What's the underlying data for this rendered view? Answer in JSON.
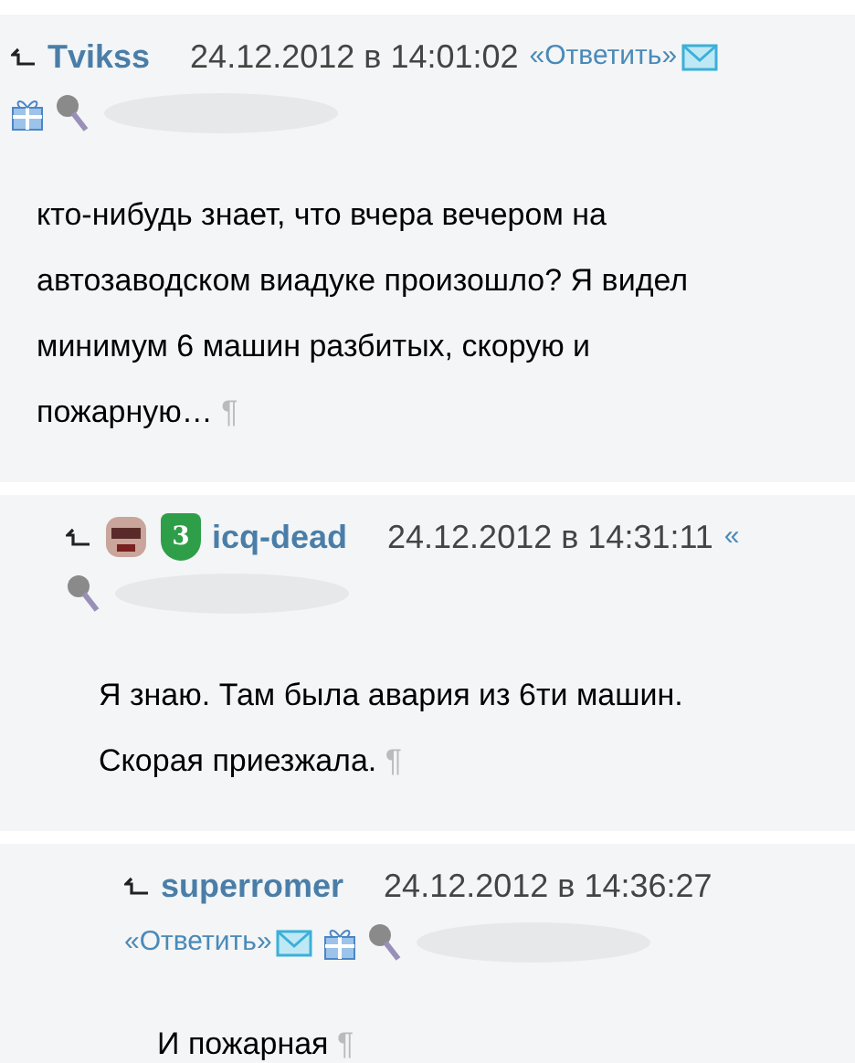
{
  "comments": [
    {
      "kind": "inline_reply",
      "author": "Tvikss",
      "time": "24.12.2012 в 14:01:02",
      "reply": "«Ответить»",
      "mail": true,
      "gift": true,
      "avatar": false,
      "text": "кто-нибудь знает, что вчера вечером на автозаводском виадуке произошло? Я видел минимум 6 машин разбитых, скорую и пожарную…",
      "mark": "¶"
    },
    {
      "kind": "inline_reply",
      "author": "icq-dead",
      "time": "24.12.2012 в 14:31:11",
      "reply": "«",
      "mail": false,
      "gift": false,
      "badge": "3",
      "avatar": true,
      "text": "Я знаю. Там была авария из 6ти машин. Скорая приезжала.",
      "mark": "¶"
    },
    {
      "kind": "reply_below",
      "author": "superromer",
      "time": "24.12.2012 в 14:36:27",
      "reply": "«Ответить»",
      "mail": true,
      "gift": true,
      "avatar": false,
      "text": "И пожарная",
      "mark": "¶"
    }
  ]
}
